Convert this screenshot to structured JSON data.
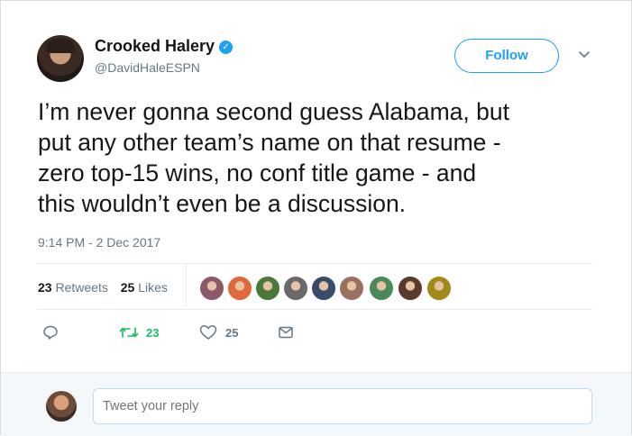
{
  "author": {
    "display_name": "Crooked Halery",
    "handle": "@DavidHaleESPN",
    "verified_glyph": "✓"
  },
  "header": {
    "follow_label": "Follow"
  },
  "tweet": {
    "text": "I’m never gonna second guess Alabama, but\nput any other team’s name on that resume -\nzero top-15 wins, no conf title game - and\nthis wouldn’t even be a discussion.",
    "timestamp": "9:14 PM - 2 Dec 2017"
  },
  "stats": {
    "retweets_count": "23",
    "retweets_label": "Retweets",
    "likes_count": "25",
    "likes_label": "Likes"
  },
  "likers": {
    "colors": [
      "#8a5a6a",
      "#e0683c",
      "#4a7a3a",
      "#6a6a6a",
      "#3a4a6a",
      "#9a7060",
      "#4a8a5a",
      "#5a3a2a",
      "#a08a1a"
    ]
  },
  "actions": {
    "reply_count": "",
    "retweet_count": "23",
    "like_count": "25"
  },
  "reply": {
    "placeholder": "Tweet your reply"
  },
  "colors": {
    "accent": "#1da1f2",
    "retweet_green": "#17bf63",
    "text_secondary": "#657786"
  }
}
